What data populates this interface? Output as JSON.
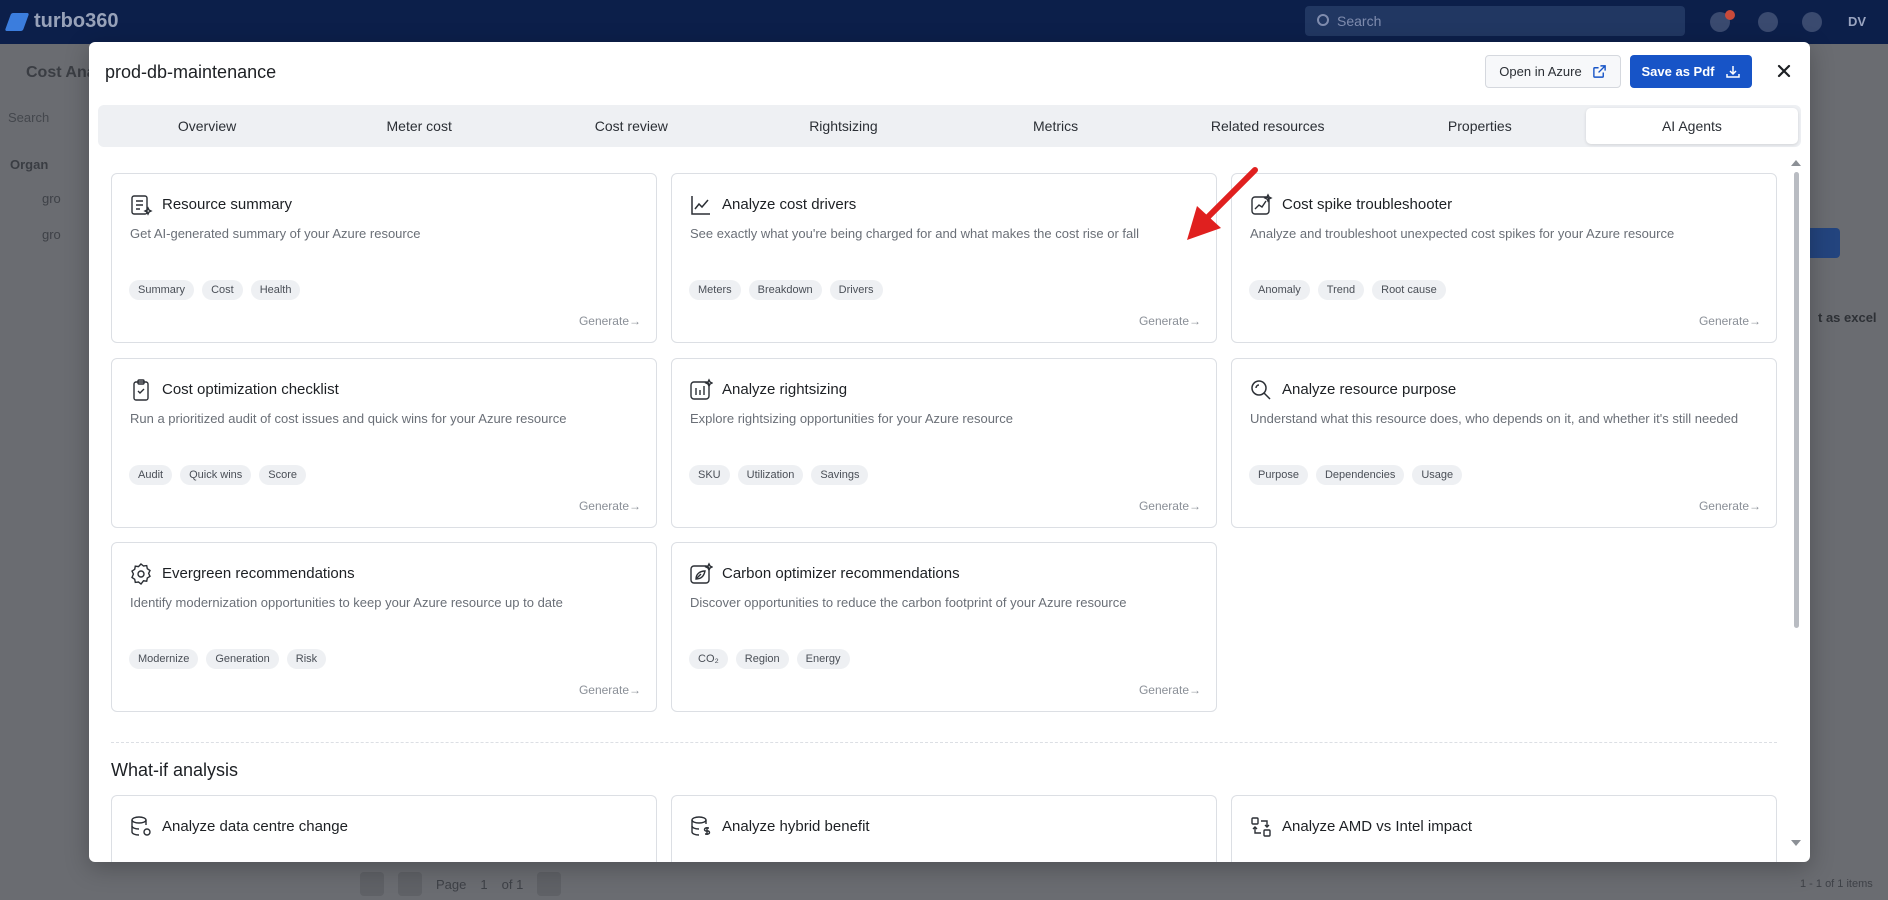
{
  "app": {
    "logo_text": "turbo360",
    "search_placeholder": "Search",
    "user_initials": "DV"
  },
  "background": {
    "page_title": "Cost Ana",
    "sidebar_search": "Search",
    "tree_root": "Organ",
    "tree_child_1": "gro",
    "tree_child_2": "gro",
    "export_label": "t as excel",
    "pager_page": "Page",
    "pager_num": "1",
    "pager_of": "of 1",
    "items_count": "1 - 1 of 1 items"
  },
  "modal": {
    "title": "prod-db-maintenance",
    "open_azure_label": "Open in Azure",
    "save_pdf_label": "Save as Pdf",
    "tabs": [
      {
        "label": "Overview"
      },
      {
        "label": "Meter cost"
      },
      {
        "label": "Cost review"
      },
      {
        "label": "Rightsizing"
      },
      {
        "label": "Metrics"
      },
      {
        "label": "Related resources"
      },
      {
        "label": "Properties"
      },
      {
        "label": "AI Agents"
      }
    ],
    "active_tab": "AI Agents",
    "generate_label": "Generate→",
    "agents": [
      {
        "title": "Resource summary",
        "icon": "document-sparkle-icon",
        "description": "Get AI-generated summary of your Azure resource",
        "tags": [
          "Summary",
          "Cost",
          "Health"
        ]
      },
      {
        "title": "Analyze cost drivers",
        "icon": "line-chart-icon",
        "description": "See exactly what you're being charged for and what makes the cost rise or fall",
        "tags": [
          "Meters",
          "Breakdown",
          "Drivers"
        ]
      },
      {
        "title": "Cost spike troubleshooter",
        "icon": "spike-chart-icon",
        "description": "Analyze and troubleshoot unexpected cost spikes for your Azure resource",
        "tags": [
          "Anomaly",
          "Trend",
          "Root cause"
        ]
      },
      {
        "title": "Cost optimization checklist",
        "icon": "clipboard-check-icon",
        "description": "Run a prioritized audit of cost issues and quick wins for your Azure resource",
        "tags": [
          "Audit",
          "Quick wins",
          "Score"
        ]
      },
      {
        "title": "Analyze rightsizing",
        "icon": "bars-sparkle-icon",
        "description": "Explore rightsizing opportunities for your Azure resource",
        "tags": [
          "SKU",
          "Utilization",
          "Savings"
        ]
      },
      {
        "title": "Analyze resource purpose",
        "icon": "magnifier-icon",
        "description": "Understand what this resource does, who depends on it, and whether it's still needed",
        "tags": [
          "Purpose",
          "Dependencies",
          "Usage"
        ]
      },
      {
        "title": "Evergreen recommendations",
        "icon": "gear-badge-icon",
        "description": "Identify modernization opportunities to keep your Azure resource up to date",
        "tags": [
          "Modernize",
          "Generation",
          "Risk"
        ]
      },
      {
        "title": "Carbon optimizer recommendations",
        "icon": "leaf-edit-icon",
        "description": "Discover opportunities to reduce the carbon footprint of your Azure resource",
        "tags": [
          "CO₂",
          "Region",
          "Energy"
        ]
      }
    ],
    "whatif": {
      "title": "What-if analysis",
      "items": [
        {
          "title": "Analyze data centre change",
          "icon": "database-location-icon"
        },
        {
          "title": "Analyze hybrid benefit",
          "icon": "database-dollar-icon"
        },
        {
          "title": "Analyze AMD vs Intel impact",
          "icon": "swap-chip-icon"
        }
      ]
    }
  },
  "colors": {
    "primary": "#1754c7",
    "arrow": "#e0201f",
    "topbar": "#0c1f4a"
  }
}
